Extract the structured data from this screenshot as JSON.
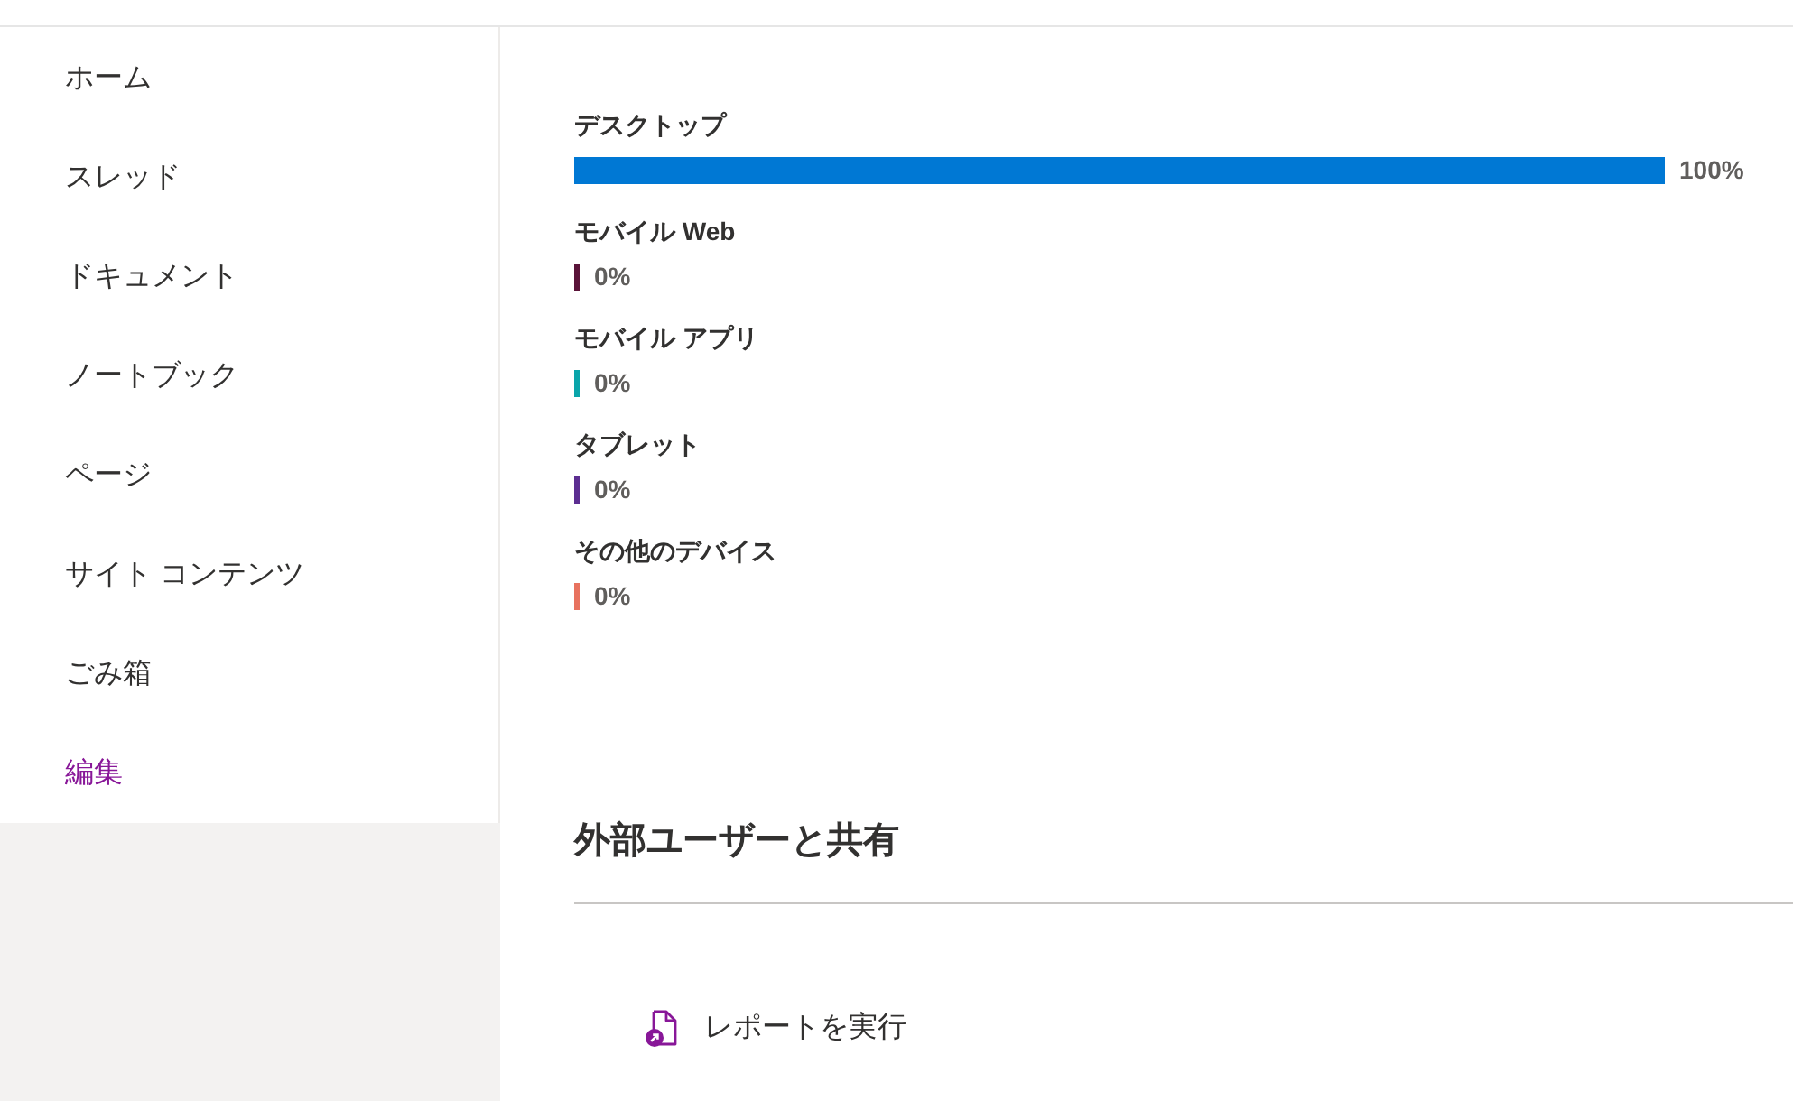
{
  "sidebar": {
    "items": [
      {
        "label": "ホーム",
        "kind": "nav"
      },
      {
        "label": "スレッド",
        "kind": "nav"
      },
      {
        "label": "ドキュメント",
        "kind": "nav"
      },
      {
        "label": "ノートブック",
        "kind": "nav"
      },
      {
        "label": "ページ",
        "kind": "nav"
      },
      {
        "label": "サイト コンテンツ",
        "kind": "nav"
      },
      {
        "label": "ごみ箱",
        "kind": "nav"
      },
      {
        "label": "編集",
        "kind": "edit"
      }
    ]
  },
  "devices": [
    {
      "label": "デスクトップ",
      "level": 1,
      "reading": "100%",
      "color": "#0078d4"
    },
    {
      "label": "モバイル Web",
      "level": 0,
      "reading": "0%",
      "color": "#5a1439"
    },
    {
      "label": "モバイル アプリ",
      "level": 0,
      "reading": "0%",
      "color": "#0aa5aa"
    },
    {
      "label": "タブレット",
      "level": 0,
      "reading": "0%",
      "color": "#5c2e91"
    },
    {
      "label": "その他のデバイス",
      "level": 0,
      "reading": "0%",
      "color": "#e8725f"
    }
  ],
  "sharing": {
    "title": "外部ユーザーと共有",
    "actions": [
      {
        "label": "レポートを実行"
      }
    ]
  }
}
